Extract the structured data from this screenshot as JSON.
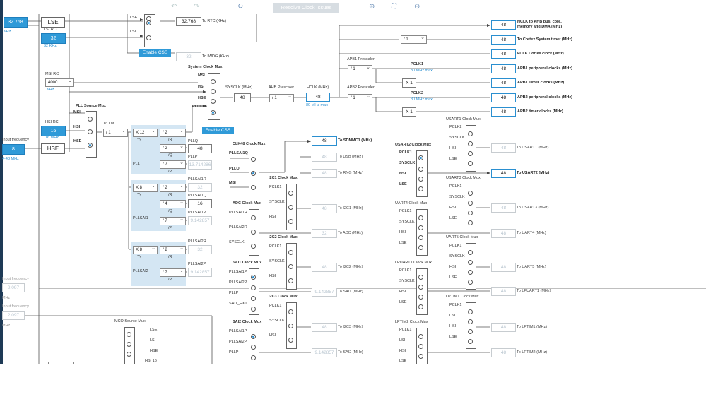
{
  "toolbar": {
    "resolve_label": "Resolve Clock Issues"
  },
  "left": {
    "lse_val": "32.768",
    "lse_unit": "KHz",
    "lse_label": "LSE",
    "lsi_rc_label": "LSI RC",
    "lsi_val": "32",
    "lsi_unit": "32 KHz",
    "msi_rc_label": "MSI RC",
    "msi_val": "4000",
    "msi_unit": "KHz",
    "hsi_rc_label": "HSI RC",
    "hsi_val": "16",
    "hsi_unit": "16 MHz",
    "input_freq_label": "Input frequency",
    "hse_val": "8",
    "hse_label": "HSE",
    "hse_range": "4-48 MHz",
    "input_freq2_label": "Input frequency",
    "input_freq2_val": "2.097",
    "input_freq2_unit": "MHz",
    "input_freq3_label": "Input frequency",
    "input_freq3_val": "2.097",
    "input_freq3_unit": "MHz"
  },
  "rtc": {
    "lse_tag": "LSE",
    "lsi_tag": "LSI",
    "hse_tag": "HSE",
    "rtc_val": "32.768",
    "rtc_label": "To RTC (KHz)",
    "enable_css": "Enable CSS",
    "iwdg_val": "32",
    "iwdg_label": "To IWDG (KHz)"
  },
  "sysmux": {
    "title": "System Clock Mux",
    "msi": "MSI",
    "hsi": "HSI",
    "hse": "HSE",
    "pllclk": "PLLCLK",
    "enable_css": "Enable CSS",
    "sysclk_label": "SYSCLK (MHz)",
    "sysclk_val": "48",
    "ahb_label": "AHB Prescaler",
    "ahb_val": "/ 1",
    "hclk_label": "HCLK (MHz)",
    "hclk_val": "48",
    "hclk_max": "80 MHz max"
  },
  "pll": {
    "source_mux": "PLL Source Mux",
    "msi": "MSI",
    "hsi": "HSI",
    "hse": "HSE",
    "pllm_label": "PLLM",
    "pllm_val": "/ 1",
    "pll_label": "PLL",
    "n_val": "X 12",
    "n_tag": "*N",
    "r_div": "/ 2",
    "r_tag": "/R",
    "q_div": "/ 2",
    "q_tag": "/Q",
    "p_div": "/ 7",
    "p_tag": "/P",
    "pllq_label": "PLLQ",
    "pllq_val": "48",
    "pllp_label": "PLLP",
    "pllp_val": "13.714286",
    "sai1_label": "PLLSAI1",
    "sai1_n": "X 8",
    "sai1_r_div": "/ 2",
    "sai1_q_div": "/ 4",
    "sai1_p_div": "/ 7",
    "sai1r_label": "PLLSAI1R",
    "sai1r_val": "32",
    "sai1q_label": "PLLSAI1Q",
    "sai1q_val": "16",
    "sai1p_label": "PLLSAI1P",
    "sai1p_val": "9.142857",
    "sai2_label": "PLLSAI2",
    "sai2_n": "X 8",
    "sai2_r_div": "/ 2",
    "sai2_p_div": "/ 7",
    "sai2r_label": "PLLSAI2R",
    "sai2r_val": "32",
    "sai2p_label": "PLLSAI2P",
    "sai2p_val": "9.142857"
  },
  "bus": {
    "apb1_label": "APB1 Prescaler",
    "apb1_val": "/ 1",
    "pclk1_label": "PCLK1",
    "pclk1_max": "80 MHz max",
    "apb2_label": "APB2 Prescaler",
    "apb2_val": "/ 1",
    "pclk2_label": "PCLK2",
    "pclk2_max": "80 MHz max",
    "systimer_div": "/ 1",
    "x1_a": "X 1",
    "x1_b": "X 1"
  },
  "outputs": [
    {
      "val": "48",
      "label": "HCLK to AHB bus, core, memory and DMA (MHz)"
    },
    {
      "val": "48",
      "label": "To Cortex System timer (MHz)"
    },
    {
      "val": "48",
      "label": "FCLK Cortex clock (MHz)"
    },
    {
      "val": "48",
      "label": "APB1 peripheral clocks (MHz)"
    },
    {
      "val": "48",
      "label": "APB1 Timer clocks (MHz)"
    },
    {
      "val": "48",
      "label": "APB2 peripheral clocks (MHz)"
    },
    {
      "val": "48",
      "label": "APB2 timer clocks (MHz)"
    }
  ],
  "clk48": {
    "title": "CLK48 Clock Mux",
    "pllsai1q": "PLLSAI1Q",
    "pllq": "PLLQ",
    "msi": "MSI",
    "sdmmc_val": "48",
    "sdmmc_label": "To SDMMC1 (MHz)",
    "usb_val": "48",
    "usb_label": "To USB (MHz)",
    "rng_val": "48",
    "rng_label": "To RNG (MHz)"
  },
  "adc": {
    "title": "ADC Clock Mux",
    "pllsai1r": "PLLSAI1R",
    "pllsai2r": "PLLSAI2R",
    "sysclk": "SYSCLK",
    "val": "32",
    "label": "To ADC (MHz)"
  },
  "i2c1": {
    "title": "I2C1 Clock Mux",
    "pclk": "PCLK1",
    "sysclk": "SYSCLK",
    "hsi": "HSI",
    "val": "48",
    "label": "To I2C1 (MHz)"
  },
  "i2c2": {
    "title": "I2C2 Clock Mux",
    "pclk": "PCLK1",
    "sysclk": "SYSCLK",
    "hsi": "HSI",
    "val": "48",
    "label": "To I2C2 (MHz)"
  },
  "i2c3": {
    "title": "I2C3 Clock Mux",
    "pclk": "PCLK1",
    "sysclk": "SYSCLK",
    "hsi": "HSI",
    "val": "48",
    "label": "To I2C3 (MHz)"
  },
  "sai1": {
    "title": "SAI1 Clock Mux",
    "a": "PLLSAI1P",
    "b": "PLLSAI2P",
    "c": "PLLP",
    "d": "SAI1_EXT",
    "val": "9.142857",
    "label": "To SAI1 (MHz)"
  },
  "sai2": {
    "title": "SAI2 Clock Mux",
    "a": "PLLSAI1P",
    "b": "PLLSAI2P",
    "c": "PLLP",
    "val": "9.142857",
    "label": "To SAI2 (MHz)"
  },
  "mco": {
    "title": "MCO Source Mux",
    "a": "LSE",
    "b": "LSI",
    "c": "HSE",
    "d": "HSI 16"
  },
  "usart1": {
    "title": "USART1 Clock Mux",
    "a": "PCLK2",
    "b": "SYSCLK",
    "c": "HSI",
    "d": "LSE",
    "val": "48",
    "label": "To USART1 (MHz)"
  },
  "usart2": {
    "title": "USART2 Clock Mux",
    "a": "PCLK1",
    "b": "SYSCLK",
    "c": "HSI",
    "d": "LSE",
    "val": "48",
    "label": "To USART2 (MHz)"
  },
  "usart3": {
    "title": "USART3 Clock Mux",
    "a": "PCLK1",
    "b": "SYSCLK",
    "c": "HSI",
    "d": "LSE",
    "val": "48",
    "label": "To USART3 (MHz)"
  },
  "uart4": {
    "title": "UART4 Clock Mux",
    "a": "PCLK1",
    "b": "SYSCLK",
    "c": "HSI",
    "d": "LSE",
    "val": "48",
    "label": "To UART4 (MHz)"
  },
  "uart5": {
    "title": "UART5 Clock Mux",
    "a": "PCLK1",
    "b": "SYSCLK",
    "c": "HSI",
    "d": "LSE",
    "val": "48",
    "label": "To UART5 (MHz)"
  },
  "lpuart1": {
    "title": "LPUART1 Clock Mux",
    "a": "PCLK1",
    "b": "SYSCLK",
    "c": "HSI",
    "d": "LSE",
    "val": "48",
    "label": "To LPUART1 (MHz)"
  },
  "lptim1": {
    "title": "LPTIM1 Clock Mux",
    "a": "PCLK1",
    "b": "LSI",
    "c": "HSI",
    "d": "LSE",
    "val": "48",
    "label": "To LPTIM1 (MHz)"
  },
  "lptim2": {
    "title": "LPTIM2 Clock Mux",
    "a": "PCLK1",
    "b": "LSI",
    "c": "HSI",
    "d": "LSE",
    "val": "48",
    "label": "To LPTIM2 (MHz)"
  },
  "colors": {
    "accent": "#2f9ad8",
    "pll_bg": "#d4e6f3",
    "dark_bar": "#1e3a56"
  }
}
